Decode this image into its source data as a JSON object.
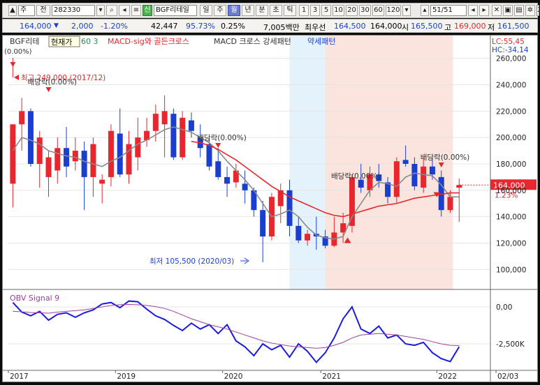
{
  "toolbar": {
    "period_label": "주",
    "prev_label": "전",
    "stock_code": "282330",
    "credit_badge": "신",
    "stock_name": "BGF리테일",
    "period_buttons": [
      "일",
      "주",
      "월",
      "년",
      "분",
      "초",
      "틱"
    ],
    "selected_period": "월",
    "interval_buttons": [
      "1",
      "3",
      "5",
      "10",
      "20",
      "30",
      "60",
      "120"
    ],
    "page_counter": "51",
    "page_total": "/51",
    "truncated_text": "2"
  },
  "quote": {
    "price": "164,000",
    "change": "2,000",
    "change_pct": "-1.20%",
    "volume": "42,447",
    "volume_ratio": "95.73%",
    "turnover_pct": "0.25%",
    "amount": "7,005백만",
    "best_label": "최우선",
    "best_ask": "164,500",
    "best_bid": "164,000",
    "open_label": "시",
    "open": "165,500",
    "high_label": "고",
    "high": "169,000",
    "low_label": "저",
    "low": "161,500"
  },
  "legend": {
    "name": "BGF리테",
    "current_tooltip": "현재가",
    "ma_periods": "60  3",
    "overlay": "MACD-sig와 골든크로스",
    "pattern": "MACD 크로스 강세패턴",
    "weak_pattern": "약세패턴",
    "left_pct": "(0.00%)"
  },
  "colors": {
    "up": "#e8262d",
    "down": "#1a3fd0",
    "ma_fast": "#8a8a8a",
    "ma_slow": "#e8262d",
    "obv": "#1a1ae0",
    "signal": "#a040a0",
    "band_weak": "#e3f2fb",
    "band_strong": "#fbe4de"
  },
  "indicator_readout": {
    "lc": "LC:55,45",
    "hc": "HC:-34,14"
  },
  "chart_data": {
    "type": "candlestick",
    "y_ticks": [
      "260,000",
      "240,000",
      "220,000",
      "200,000",
      "180,000",
      "160,000",
      "140,000",
      "120,000",
      "100,000"
    ],
    "ylim": [
      88000,
      272000
    ],
    "price_label": "164,000",
    "price_label_pct": "1.23%",
    "annotations": {
      "max": "최고 249,000 (2017/12)",
      "min": "최저 105,500 (2020/03)",
      "dividends": [
        "배당락(0.00%)",
        "배당락(0.00%)",
        "배당락(0.00%)",
        "배당락(0.00%)"
      ]
    },
    "candles": [
      [
        165000,
        210000,
        147000,
        210000
      ],
      [
        210000,
        230000,
        190000,
        220000
      ],
      [
        220000,
        222000,
        178000,
        180000
      ],
      [
        180000,
        205000,
        162000,
        200000
      ],
      [
        170000,
        190000,
        155000,
        185000
      ],
      [
        175000,
        200000,
        165000,
        192000
      ],
      [
        192000,
        208000,
        170000,
        178000
      ],
      [
        182000,
        200000,
        175000,
        190000
      ],
      [
        190000,
        197000,
        145000,
        170000
      ],
      [
        170000,
        200000,
        155000,
        195000
      ],
      [
        165000,
        172000,
        150000,
        168000
      ],
      [
        170000,
        210000,
        163000,
        205000
      ],
      [
        203000,
        222000,
        170000,
        172000
      ],
      [
        172000,
        205000,
        165000,
        195000
      ],
      [
        185000,
        215000,
        175000,
        200000
      ],
      [
        198000,
        215000,
        193000,
        205000
      ],
      [
        205000,
        225000,
        197000,
        218000
      ],
      [
        210000,
        232000,
        185000,
        220000
      ],
      [
        218000,
        222000,
        183000,
        185000
      ],
      [
        185000,
        220000,
        183000,
        215000
      ],
      [
        213000,
        219000,
        200000,
        205000
      ],
      [
        200000,
        210000,
        185000,
        192000
      ],
      [
        195000,
        200000,
        175000,
        178000
      ],
      [
        182000,
        192000,
        168000,
        170000
      ],
      [
        170000,
        178000,
        155000,
        165000
      ],
      [
        166000,
        180000,
        162000,
        175000
      ],
      [
        165000,
        175000,
        150000,
        160000
      ],
      [
        160000,
        162000,
        140000,
        145000
      ],
      [
        145000,
        152000,
        105500,
        125000
      ],
      [
        125000,
        158000,
        122000,
        155000
      ],
      [
        148000,
        165000,
        135000,
        160000
      ],
      [
        160000,
        168000,
        125000,
        133000
      ],
      [
        133000,
        140000,
        120000,
        122000
      ],
      [
        122000,
        130000,
        118000,
        127000
      ],
      [
        127000,
        140000,
        115000,
        125000
      ],
      [
        125000,
        130000,
        116000,
        118000
      ],
      [
        118000,
        140000,
        117000,
        128000
      ],
      [
        128000,
        143000,
        120000,
        135000
      ],
      [
        133000,
        172000,
        128000,
        170000
      ],
      [
        168000,
        180000,
        158000,
        162000
      ],
      [
        160000,
        178000,
        155000,
        172000
      ],
      [
        172000,
        180000,
        162000,
        167000
      ],
      [
        166000,
        170000,
        150000,
        155000
      ],
      [
        155000,
        185000,
        150000,
        182000
      ],
      [
        183000,
        194000,
        178000,
        180000
      ],
      [
        180000,
        185000,
        160000,
        163000
      ],
      [
        162000,
        185000,
        158000,
        178000
      ],
      [
        178000,
        185000,
        168000,
        172000
      ],
      [
        170000,
        175000,
        140000,
        145000
      ],
      [
        145000,
        160000,
        143000,
        155000
      ],
      [
        162000,
        169000,
        136000,
        164000
      ]
    ],
    "ma_fast": [
      190000,
      200000,
      198000,
      195000,
      190000,
      188000,
      186000,
      185000,
      182000,
      180000,
      178000,
      182000,
      185000,
      190000,
      195000,
      198000,
      202000,
      206000,
      208000,
      206000,
      204000,
      200000,
      196000,
      190000,
      182000,
      175000,
      168000,
      160000,
      150000,
      140000,
      142000,
      145000,
      140000,
      132000,
      126000,
      124000,
      123000,
      125000,
      140000,
      150000,
      160000,
      166000,
      165000,
      163000,
      170000,
      173000,
      172000,
      171000,
      164000,
      155000,
      155000
    ],
    "ma_slow_start_index": 20,
    "ma_slow": [
      197000,
      196000,
      194000,
      191000,
      187000,
      183000,
      178000,
      173000,
      168000,
      163000,
      159000,
      155000,
      152000,
      149000,
      146000,
      143000,
      141000,
      140000,
      142000,
      144000,
      146000,
      148000,
      149000,
      150000,
      152000,
      154000,
      155000,
      156000,
      157000,
      158000,
      158000
    ],
    "obv_signal": {
      "title": "OBV  Signal 9",
      "y_ticks": [
        "0,00",
        "-2,500K"
      ],
      "obv": [
        300,
        -350,
        -600,
        -300,
        -900,
        -500,
        -400,
        -700,
        -400,
        -200,
        200,
        300,
        -50,
        400,
        350,
        -150,
        -600,
        -850,
        -1250,
        -1600,
        -1100,
        -1500,
        -1200,
        -1800,
        -1200,
        -2300,
        -2700,
        -3300,
        -2500,
        -2900,
        -2600,
        -3400,
        -2500,
        -3000,
        -3750,
        -3100,
        -2100,
        -800,
        0,
        -1500,
        -1800,
        -1300,
        -2100,
        -1900,
        -2500,
        -2600,
        -2400,
        -3100,
        -3500,
        -3700,
        -2700
      ],
      "signal": [
        -300,
        -330,
        -380,
        -400,
        -420,
        -350,
        -300,
        -250,
        -200,
        -100,
        0,
        100,
        150,
        170,
        150,
        100,
        20,
        -100,
        -300,
        -550,
        -800,
        -1000,
        -1200,
        -1350,
        -1500,
        -1700,
        -1900,
        -2100,
        -2300,
        -2450,
        -2550,
        -2650,
        -2700,
        -2750,
        -2800,
        -2750,
        -2600,
        -2400,
        -2100,
        -1900,
        -1850,
        -1800,
        -1850,
        -1900,
        -2000,
        -2100,
        -2200,
        -2350,
        -2500,
        -2600,
        -2620
      ],
      "ylim": [
        -4200,
        900
      ]
    },
    "x_ticks": [
      {
        "label": "2017",
        "index": 0
      },
      {
        "label": "2019",
        "index": 12
      },
      {
        "label": "2020",
        "index": 24
      },
      {
        "label": "2021",
        "index": 35
      },
      {
        "label": "2022",
        "index": 48
      },
      {
        "label": "02/03",
        "index": 53
      }
    ],
    "bands": [
      {
        "kind": "weak",
        "from_index": 31.5,
        "to_index": 35.5
      },
      {
        "kind": "strong",
        "from_index": 35.5,
        "to_index": 49.8
      }
    ]
  }
}
